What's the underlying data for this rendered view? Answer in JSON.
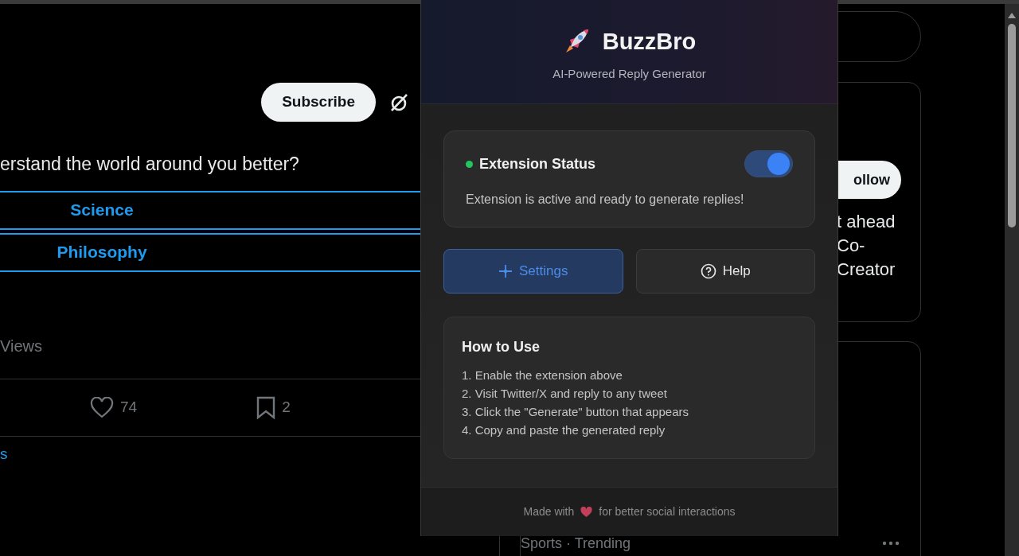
{
  "page": {
    "subscribe_button": "Subscribe",
    "question": "erstand the world around you better?",
    "poll_options": [
      {
        "label": "Science"
      },
      {
        "label": "Philosophy"
      }
    ],
    "views": "Views",
    "actions": [
      {
        "kind": "like",
        "count": "74"
      },
      {
        "kind": "bookmark",
        "count": "2"
      }
    ],
    "link_fragment": "s",
    "follow_button": "ollow",
    "sidebar_text": [
      "t ahead",
      "Co-",
      "Creator"
    ],
    "trend": "Sports · Trending"
  },
  "popup": {
    "title": "BuzzBro",
    "subtitle": "AI-Powered Reply Generator",
    "status": {
      "title": "Extension Status",
      "on": true,
      "message": "Extension is active and ready to generate replies!"
    },
    "buttons": [
      {
        "kind": "settings",
        "label": "Settings",
        "selected": true
      },
      {
        "kind": "help",
        "label": "Help",
        "selected": false
      }
    ],
    "how_to": {
      "title": "How to Use",
      "steps": [
        "1. Enable the extension above",
        "2. Visit Twitter/X and reply to any tweet",
        "3. Click the \"Generate\" button that appears",
        "4. Copy and paste the generated reply"
      ]
    },
    "footer": {
      "before": "Made with",
      "after": "for better social interactions"
    }
  }
}
